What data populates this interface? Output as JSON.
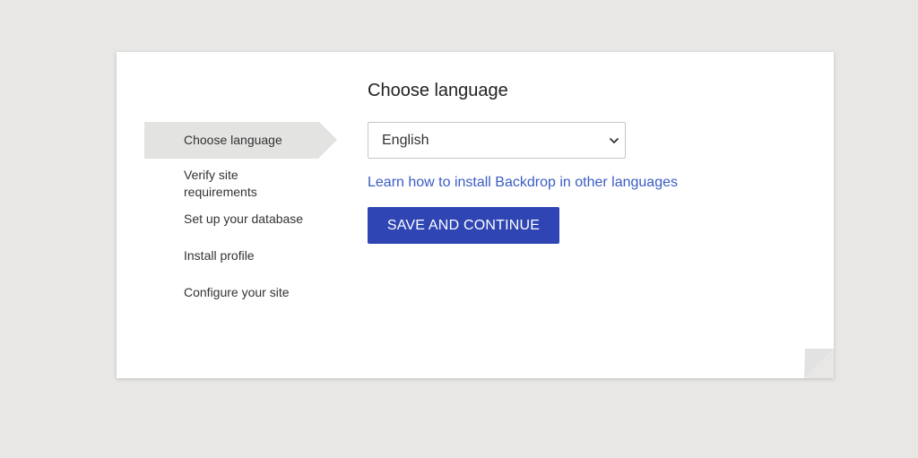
{
  "steps": [
    {
      "label": "Choose language",
      "active": true
    },
    {
      "label": "Verify site requirements",
      "active": false
    },
    {
      "label": "Set up your database",
      "active": false
    },
    {
      "label": "Install profile",
      "active": false
    },
    {
      "label": "Configure your site",
      "active": false
    }
  ],
  "main": {
    "title": "Choose language",
    "language_select": {
      "selected": "English"
    },
    "help_link": "Learn how to install Backdrop in other languages",
    "submit_label": "SAVE AND CONTINUE"
  },
  "colors": {
    "page_background": "#e8e7e5",
    "active_step": "#e3e3e2",
    "link": "#3b5cc4",
    "button": "#2e45b3"
  },
  "icons": {
    "select": "chevron-down-icon",
    "corner": "page-fold-icon"
  }
}
